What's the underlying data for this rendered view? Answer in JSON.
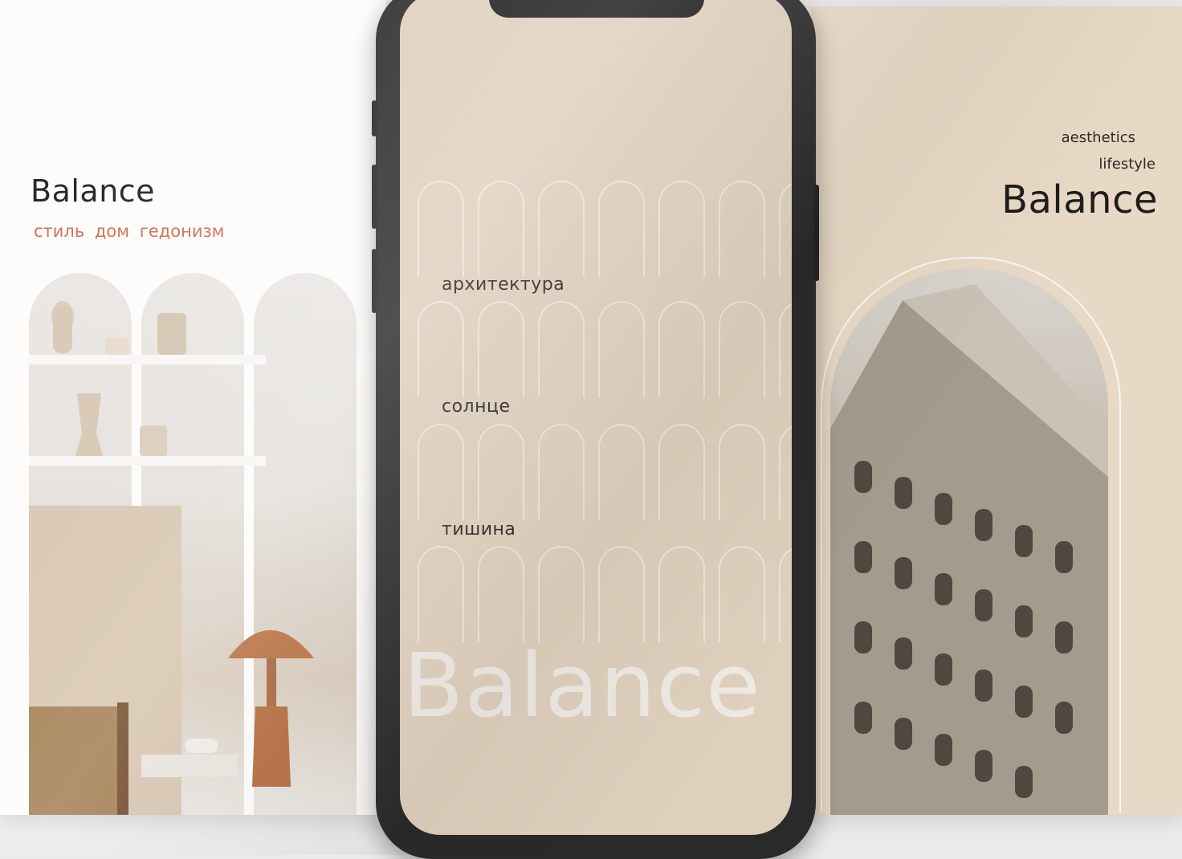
{
  "left_card": {
    "title": "Balance",
    "tags": "стиль  дом  гедонизм",
    "photo_icon": "interior-shelves-photo"
  },
  "phone": {
    "words": [
      "архитектура",
      "солнце",
      "тишина"
    ],
    "big_title": "Balance"
  },
  "right_card": {
    "tag1": "aesthetics",
    "tag2": "lifestyle",
    "title": "Balance",
    "photo_icon": "building-photo"
  },
  "colors": {
    "accent": "#d2674a",
    "beige": "#e8d9c6",
    "phone_frame": "#2a2a2b"
  }
}
